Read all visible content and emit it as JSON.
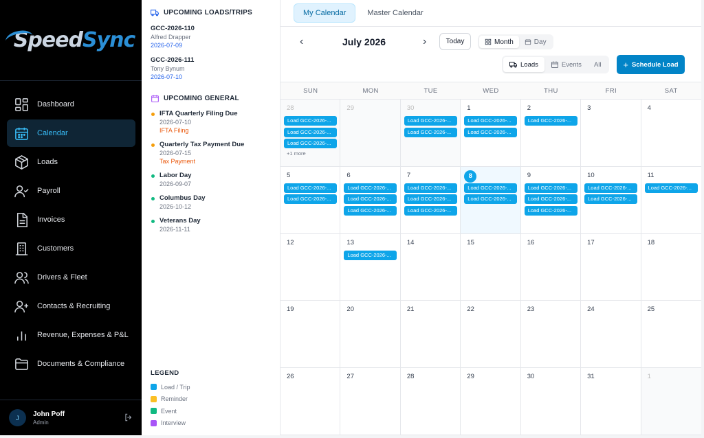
{
  "app": {
    "logo_left": "Speed",
    "logo_right": "Sync"
  },
  "sidebar": {
    "items": [
      {
        "label": "Dashboard"
      },
      {
        "label": "Calendar"
      },
      {
        "label": "Loads"
      },
      {
        "label": "Payroll"
      },
      {
        "label": "Invoices"
      },
      {
        "label": "Customers"
      },
      {
        "label": "Drivers & Fleet"
      },
      {
        "label": "Contacts & Recruiting"
      },
      {
        "label": "Revenue, Expenses & P&L"
      },
      {
        "label": "Documents & Compliance"
      }
    ],
    "user": {
      "initial": "J",
      "name": "John Poff",
      "role": "Admin"
    }
  },
  "upcoming_loads": {
    "title": "UPCOMING LOADS/TRIPS",
    "items": [
      {
        "id": "GCC-2026-110",
        "name": "Alfred Drapper",
        "date": "2026-07-09"
      },
      {
        "id": "GCC-2026-111",
        "name": "Tony Bynum",
        "date": "2026-07-10"
      }
    ]
  },
  "upcoming_general": {
    "title": "UPCOMING GENERAL",
    "items": [
      {
        "title": "IFTA Quarterly Filing Due",
        "date": "2026-07-10",
        "type": "IFTA Filing",
        "color": "#f59e0b"
      },
      {
        "title": "Quarterly Tax Payment Due",
        "date": "2026-07-15",
        "type": "Tax Payment",
        "color": "#f59e0b"
      },
      {
        "title": "Labor Day",
        "date": "2026-09-07",
        "type": "",
        "color": "#10b981"
      },
      {
        "title": "Columbus Day",
        "date": "2026-10-12",
        "type": "",
        "color": "#10b981"
      },
      {
        "title": "Veterans Day",
        "date": "2026-11-11",
        "type": "",
        "color": "#10b981"
      }
    ]
  },
  "legend": {
    "title": "LEGEND",
    "items": [
      {
        "label": "Load / Trip",
        "color": "#0ea5e9"
      },
      {
        "label": "Reminder",
        "color": "#fbbf24"
      },
      {
        "label": "Event",
        "color": "#10b981"
      },
      {
        "label": "Interview",
        "color": "#a855f7"
      }
    ]
  },
  "calendar": {
    "tabs": [
      "My Calendar",
      "Master Calendar"
    ],
    "month_title": "July 2026",
    "prev": "‹",
    "next": "›",
    "today_label": "Today",
    "view_month": "Month",
    "view_day": "Day",
    "filter_loads": "Loads",
    "filter_events": "Events",
    "filter_all": "All",
    "schedule_label": "Schedule Load",
    "dow": [
      "SUN",
      "MON",
      "TUE",
      "WED",
      "THU",
      "FRI",
      "SAT"
    ],
    "event_label": "Load GCC-2026-...",
    "more_label": "+1 more",
    "days": [
      {
        "n": "28",
        "other": true,
        "events": 3,
        "more": true
      },
      {
        "n": "29",
        "other": true,
        "events": 0
      },
      {
        "n": "30",
        "other": true,
        "events": 2
      },
      {
        "n": "1",
        "events": 2
      },
      {
        "n": "2",
        "events": 1
      },
      {
        "n": "3",
        "events": 0
      },
      {
        "n": "4",
        "events": 0
      },
      {
        "n": "5",
        "events": 2
      },
      {
        "n": "6",
        "events": 3
      },
      {
        "n": "7",
        "events": 3
      },
      {
        "n": "8",
        "today": true,
        "events": 2
      },
      {
        "n": "9",
        "events": 3
      },
      {
        "n": "10",
        "events": 2
      },
      {
        "n": "11",
        "events": 1
      },
      {
        "n": "12",
        "events": 0
      },
      {
        "n": "13",
        "events": 1
      },
      {
        "n": "14",
        "events": 0
      },
      {
        "n": "15",
        "events": 0
      },
      {
        "n": "16",
        "events": 0
      },
      {
        "n": "17",
        "events": 0
      },
      {
        "n": "18",
        "events": 0
      },
      {
        "n": "19",
        "events": 0
      },
      {
        "n": "20",
        "events": 0
      },
      {
        "n": "21",
        "events": 0
      },
      {
        "n": "22",
        "events": 0
      },
      {
        "n": "23",
        "events": 0
      },
      {
        "n": "24",
        "events": 0
      },
      {
        "n": "25",
        "events": 0
      },
      {
        "n": "26",
        "events": 0
      },
      {
        "n": "27",
        "events": 0
      },
      {
        "n": "28",
        "events": 0
      },
      {
        "n": "29",
        "events": 0
      },
      {
        "n": "30",
        "events": 0
      },
      {
        "n": "31",
        "events": 0
      },
      {
        "n": "1",
        "other": true,
        "events": 0
      }
    ]
  }
}
